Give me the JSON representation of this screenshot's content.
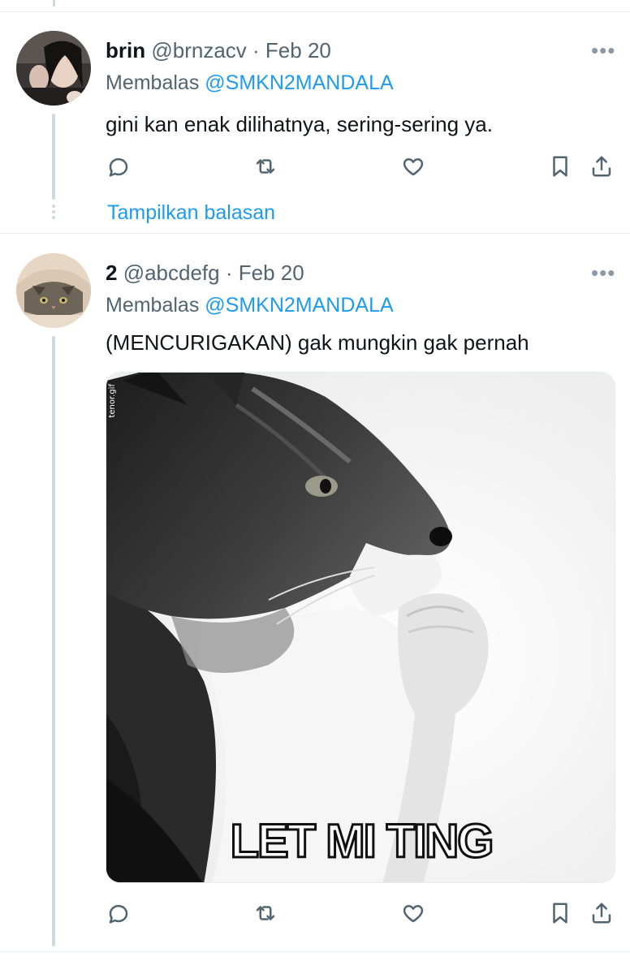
{
  "tweets": [
    {
      "name": "brin",
      "handle": "@brnzacv",
      "separator": "·",
      "date": "Feb 20",
      "reply_prefix": "Membalas",
      "reply_to": "@SMKN2MANDALA",
      "text": "gini kan enak dilihatnya, sering-sering ya.",
      "more_label": "•••",
      "show_replies": "Tampilkan balasan"
    },
    {
      "name": "2",
      "handle": "@abcdefg",
      "separator": "·",
      "date": "Feb 20",
      "reply_prefix": "Membalas",
      "reply_to": "@SMKN2MANDALA",
      "text": "(MENCURIGAKAN) gak mungkin gak pernah",
      "more_label": "•••",
      "media": {
        "caption": "LET MI TING",
        "watermark": "tenor.gif"
      }
    }
  ],
  "icons": [
    "reply-icon",
    "retweet-icon",
    "like-icon",
    "bookmark-icon",
    "share-icon"
  ],
  "colors": {
    "accent": "#1d9bf0",
    "secondary_text": "#536471",
    "thread_line": "#cfd9de",
    "divider": "#e6ecf0"
  }
}
